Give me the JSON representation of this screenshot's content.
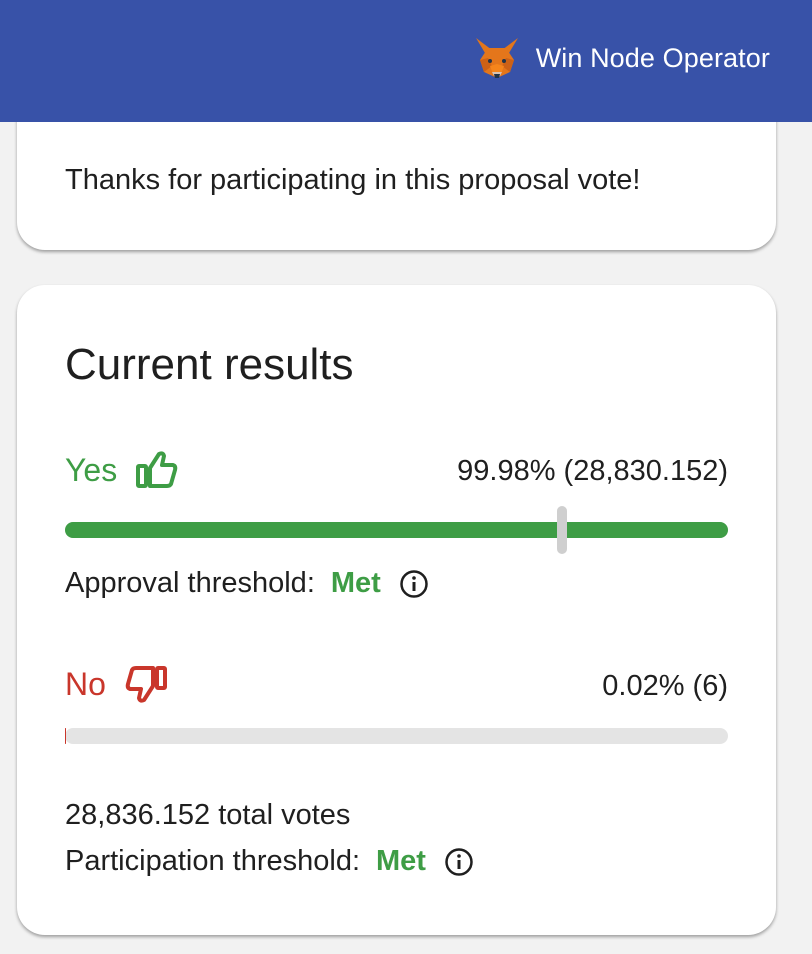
{
  "header": {
    "account_name": "Win Node Operator",
    "account_icon": "metamask-fox-icon",
    "background_color": "#3852a8"
  },
  "thanks_card": {
    "message": "Thanks for participating in this proposal vote!"
  },
  "results": {
    "title": "Current results",
    "yes": {
      "label": "Yes",
      "icon": "thumbs-up-icon",
      "value_text": "99.98% (28,830.152)",
      "percent": 99.98,
      "color": "#3e9d45"
    },
    "approval": {
      "label": "Approval threshold:",
      "status": "Met",
      "threshold_percent": 75
    },
    "no": {
      "label": "No",
      "icon": "thumbs-down-icon",
      "value_text": "0.02% (6)",
      "percent": 0.02,
      "color": "#c9362b"
    },
    "total_votes": "28,836.152 total votes",
    "participation": {
      "label": "Participation threshold:",
      "status": "Met"
    }
  }
}
